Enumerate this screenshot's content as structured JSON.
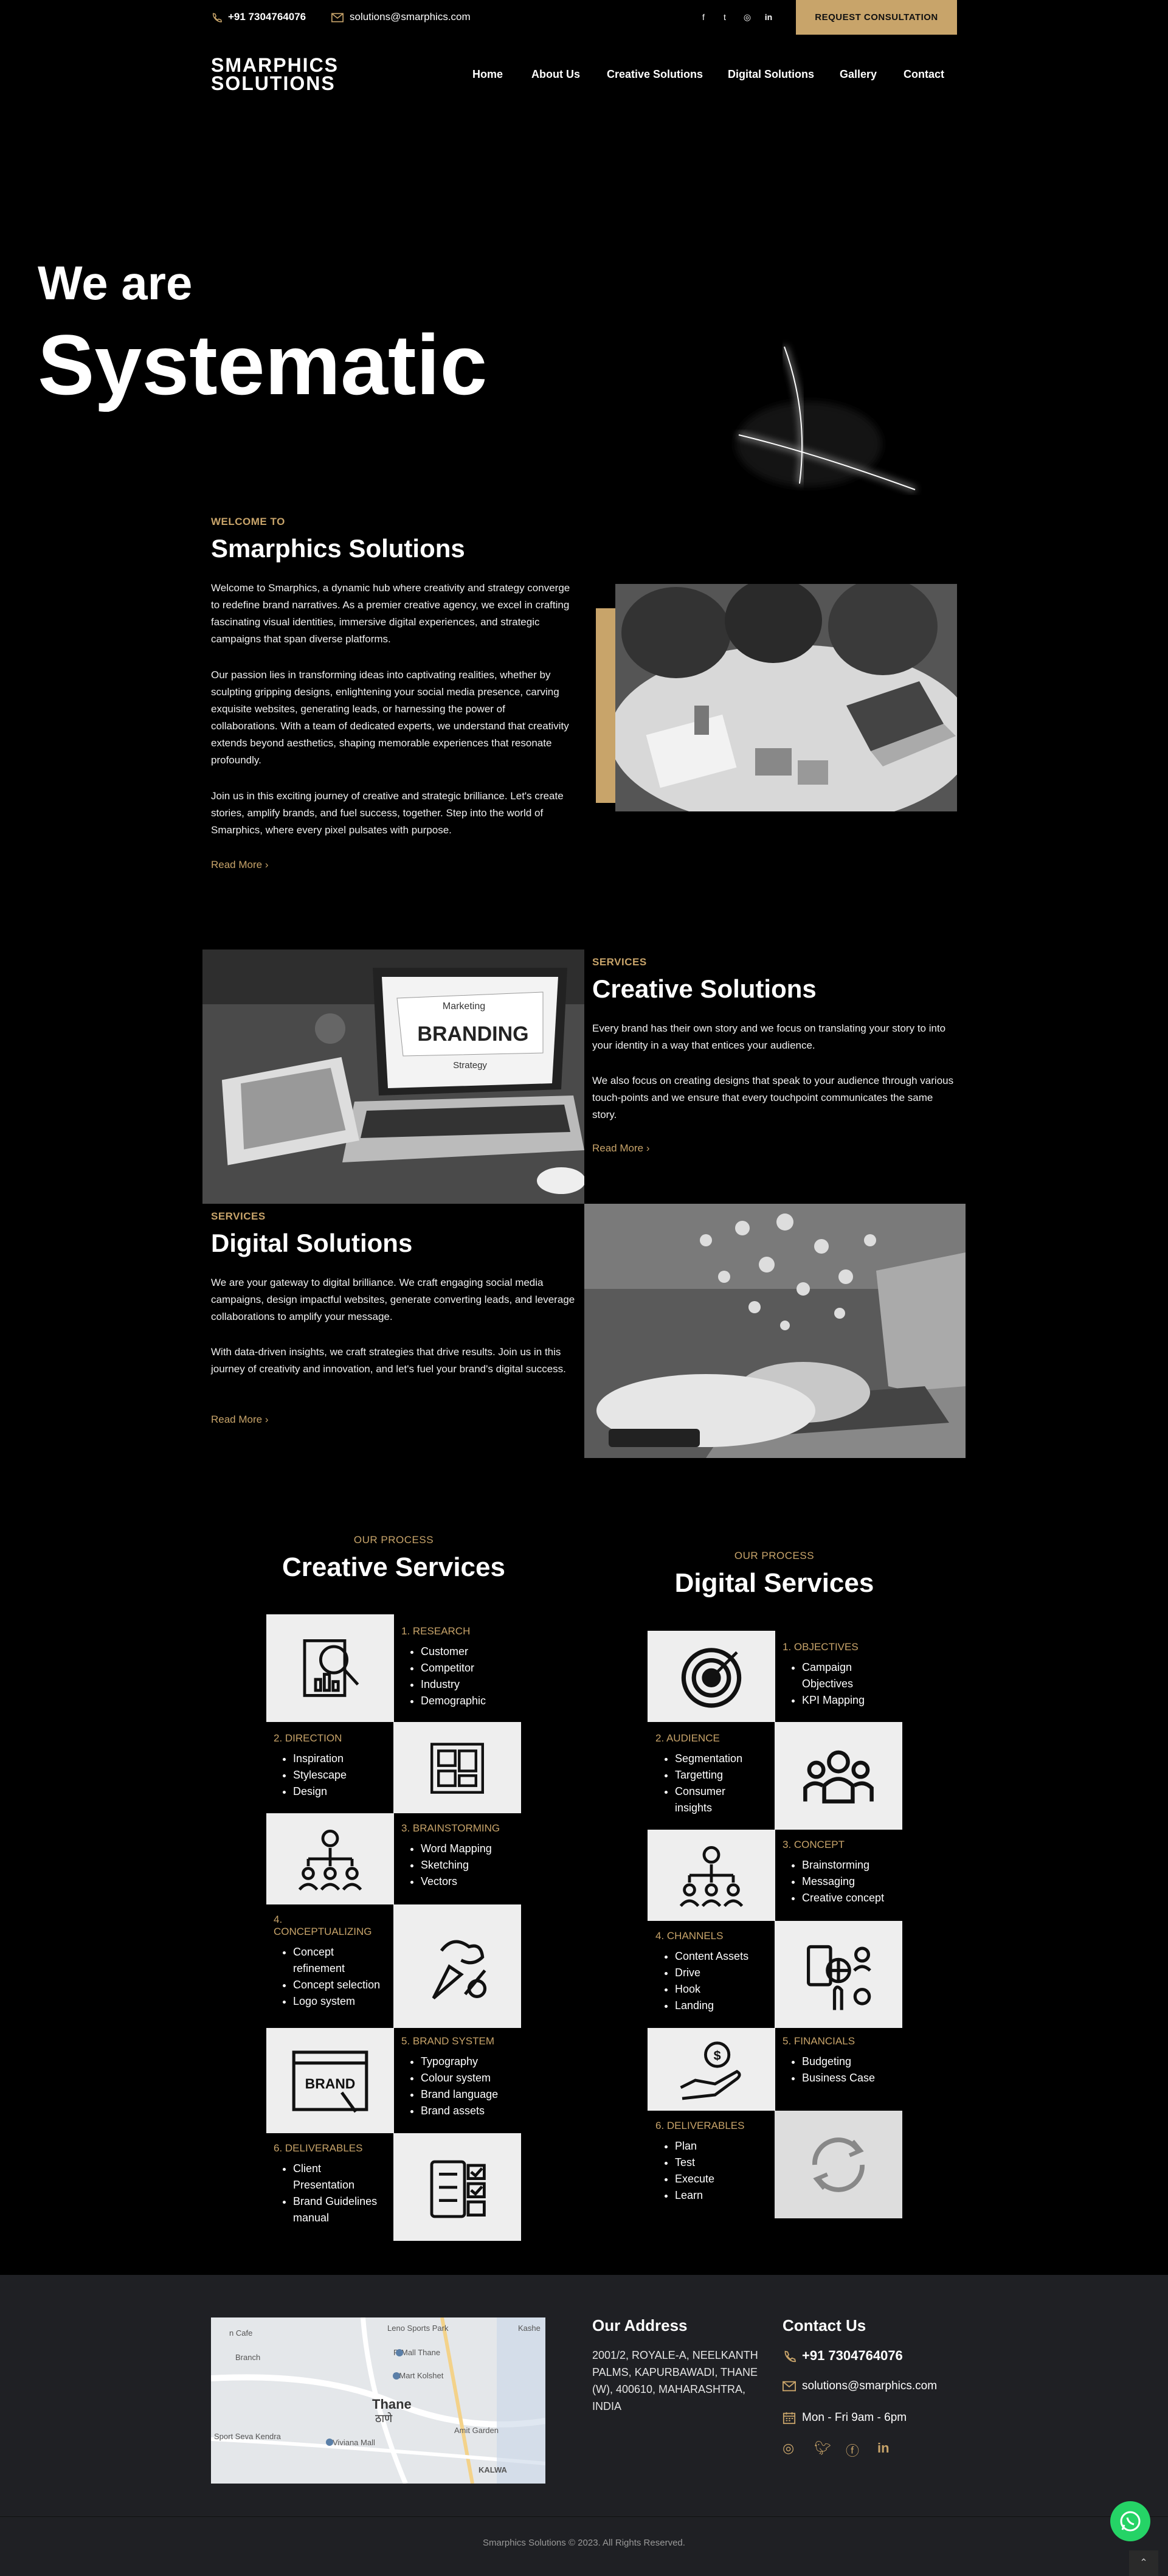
{
  "topbar": {
    "phone": "+91 7304764076",
    "email": "solutions@smarphics.com",
    "social_icons": [
      "facebook-icon",
      "twitter-icon",
      "instagram-icon",
      "linkedin-icon"
    ],
    "cta_label": "REQUEST CONSULTATION"
  },
  "header": {
    "logo_line1": "SMARPHICS",
    "logo_line2": "SOLUTIONS",
    "nav": [
      "Home",
      "About Us",
      "Creative Solutions",
      "Digital Solutions",
      "Gallery",
      "Contact"
    ]
  },
  "hero": {
    "line1": "We are",
    "line2": "Systematic"
  },
  "welcome": {
    "tag": "WELCOME TO",
    "title": "Smarphics Solutions",
    "p1": "Welcome to Smarphics, a dynamic hub where creativity and strategy converge to redefine brand narratives. As a premier creative agency, we excel in crafting fascinating visual identities, immersive digital experiences, and strategic campaigns that span diverse platforms.",
    "p2": "Our passion lies in transforming ideas into captivating realities, whether by sculpting gripping designs, enlightening your social media presence, carving exquisite websites, generating leads, or harnessing the power of collaborations. With a team of dedicated experts, we understand that creativity extends beyond aesthetics, shaping memorable experiences that resonate profoundly.",
    "p3": "Join us in this exciting journey of creative and strategic brilliance. Let's create stories, amplify brands, and fuel success, together. Step into the world of Smarphics, where every pixel pulsates with purpose.",
    "read_more": "Read More"
  },
  "creative": {
    "tag": "SERVICES",
    "title": "Creative Solutions",
    "p1": "Every brand has their own story and we focus on translating your story to into your identity in a way that entices your audience.",
    "p2": "We also focus on creating designs that speak to your audience through various touch-points and we ensure that every touchpoint communicates the same story.",
    "read_more": "Read More",
    "img_text1": "Marketing",
    "img_text2": "BRANDING",
    "img_text3": "Strategy"
  },
  "digital": {
    "tag": "SERVICES",
    "title": "Digital Solutions",
    "p1": "We are your gateway to digital brilliance. We craft engaging social media campaigns, design impactful websites, generate converting leads, and leverage collaborations to amplify your message.",
    "p2": "With data-driven insights, we craft strategies that drive results. Join us in this journey of creativity and innovation, and let's fuel your brand's digital success.",
    "read_more": "Read More"
  },
  "process_creative": {
    "tag": "OUR PROCESS",
    "title": "Creative Services",
    "steps": [
      {
        "title": "1. RESEARCH",
        "items": [
          "Customer",
          "Competitor",
          "Industry",
          "Demographic"
        ],
        "icon": "research-report-icon"
      },
      {
        "title": "2. DIRECTION",
        "items": [
          "Inspiration",
          "Stylescape",
          "Design"
        ],
        "icon": "moodboard-icon"
      },
      {
        "title": "3. BRAINSTORMING",
        "items": [
          "Word Mapping",
          "Sketching",
          "Vectors"
        ],
        "icon": "team-idea-icon"
      },
      {
        "title": "4. CONCEPTUALIZING",
        "items": [
          "Concept refinement",
          "Concept selection",
          "Logo system"
        ],
        "icon": "creative-tools-icon"
      },
      {
        "title": "5. BRAND SYSTEM",
        "items": [
          "Typography",
          "Colour system",
          "Brand language",
          "Brand assets"
        ],
        "icon": "brand-board-icon"
      },
      {
        "title": "6. DELIVERABLES",
        "items": [
          "Client Presentation",
          "Brand Guidelines manual"
        ],
        "icon": "checklist-icon"
      }
    ]
  },
  "process_digital": {
    "tag": "OUR PROCESS",
    "title": "Digital Services",
    "steps": [
      {
        "title": "1. OBJECTIVES",
        "items": [
          "Campaign Objectives",
          "KPI Mapping"
        ],
        "icon": "target-icon"
      },
      {
        "title": "2. AUDIENCE",
        "items": [
          "Segmentation",
          "Targetting",
          "Consumer insights"
        ],
        "icon": "audience-icon"
      },
      {
        "title": "3. CONCEPT",
        "items": [
          "Brainstorming",
          "Messaging",
          "Creative concept"
        ],
        "icon": "team-idea-icon"
      },
      {
        "title": "4. CHANNELS",
        "items": [
          "Content Assets",
          "Drive",
          "Hook",
          "Landing"
        ],
        "icon": "channels-icon"
      },
      {
        "title": "5. FINANCIALS",
        "items": [
          "Budgeting",
          "Business Case"
        ],
        "icon": "money-hand-icon"
      },
      {
        "title": "6. DELIVERABLES",
        "items": [
          "Plan",
          "Test",
          "Execute",
          "Learn"
        ],
        "icon": "refresh-cycle-icon"
      }
    ]
  },
  "footer": {
    "map_labels": [
      "Leno Sports Park",
      "Kashe",
      "R Mall Thane",
      "DMart Kolshet",
      "Thane",
      "ठाणे",
      "Viviana Mall",
      "Amit Garden",
      "KALWA",
      "Sport Seva Kendra",
      "Branch",
      "n Cafe"
    ],
    "address_title": "Our Address",
    "address": "2001/2, ROYALE-A, NEELKANTH PALMS, KAPURBAWADI, THANE (W), 400610, MAHARASHTRA, INDIA",
    "contact_title": "Contact Us",
    "phone": "+91 7304764076",
    "email": "solutions@smarphics.com",
    "hours": "Mon - Fri 9am - 6pm",
    "social_icons": [
      "instagram-icon",
      "twitter-icon",
      "facebook-icon",
      "linkedin-icon"
    ],
    "copyright": "Smarphics Solutions © 2023. All Rights Reserved."
  },
  "colors": {
    "accent": "#c8a46a",
    "background": "#000000",
    "footer": "#1f2024",
    "whatsapp": "#25d366"
  }
}
